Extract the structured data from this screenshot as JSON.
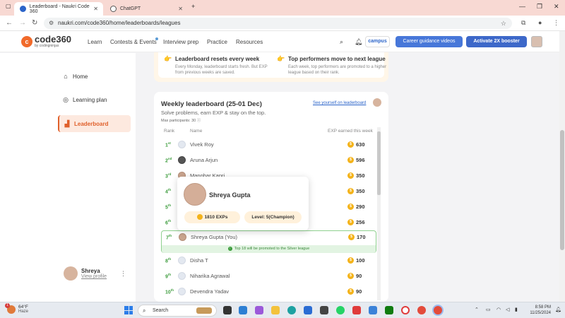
{
  "browser": {
    "tabs": [
      {
        "title": "Leaderboard - Naukri Code 360",
        "active": true,
        "favicon_color": "#2b64c9"
      },
      {
        "title": "ChatGPT",
        "active": false,
        "favicon_color": "#555555"
      }
    ],
    "url": "naukri.com/code360/home/leaderboards/leagues"
  },
  "header": {
    "logo_text": "code360",
    "logo_sub": "by codingninjas",
    "nav": [
      "Learn",
      "Contests & Events",
      "Interview prep",
      "Practice",
      "Resources"
    ],
    "campus_label": "campus",
    "career_btn": "Career guidance videos",
    "booster_btn": "Activate 2X booster"
  },
  "sidebar": {
    "items": [
      {
        "label": "Home",
        "icon": "home-icon",
        "active": false
      },
      {
        "label": "Learning plan",
        "icon": "compass-icon",
        "active": false
      },
      {
        "label": "Leaderboard",
        "icon": "leaderboard-icon",
        "active": true
      }
    ],
    "profile": {
      "name": "Shreya",
      "link": "View profile"
    }
  },
  "info": {
    "left": {
      "title": "Leaderboard resets every week",
      "desc": "Every Monday, leaderboard starts fresh. But EXP from previous weeks are saved."
    },
    "right": {
      "title": "Top performers move to next league",
      "desc": "Each week, top performers are promoted to a higher league based on their rank."
    }
  },
  "leaderboard": {
    "title": "Weekly leaderboard (25-01 Dec)",
    "subtitle": "Solve problems, earn EXP & stay on the top.",
    "max_participants": "Max participants: 30",
    "see_yourself": "See yourself on leaderboard",
    "col_rank": "Rank",
    "col_name": "Name",
    "col_exp": "EXP earned this week",
    "rows": [
      {
        "rank": "1",
        "suffix": "st",
        "name": "Vivek Roy",
        "exp": "630",
        "avatar": "default"
      },
      {
        "rank": "2",
        "suffix": "nd",
        "name": "Aruna Arjun",
        "exp": "596",
        "avatar": "dark"
      },
      {
        "rank": "3",
        "suffix": "rd",
        "name": "Manohar Kapri",
        "exp": "350",
        "avatar": "photo"
      },
      {
        "rank": "4",
        "suffix": "th",
        "name": "",
        "exp": "350",
        "avatar": "default"
      },
      {
        "rank": "5",
        "suffix": "th",
        "name": "",
        "exp": "290",
        "avatar": "default"
      },
      {
        "rank": "6",
        "suffix": "th",
        "name": "",
        "exp": "256",
        "avatar": "default"
      },
      {
        "rank": "7",
        "suffix": "th",
        "name": "Shreya Gupta (You)",
        "exp": "170",
        "avatar": "photo"
      },
      {
        "rank": "8",
        "suffix": "th",
        "name": "Disha T",
        "exp": "100",
        "avatar": "default"
      },
      {
        "rank": "9",
        "suffix": "th",
        "name": "Niharika Agrawal",
        "exp": "90",
        "avatar": "default"
      },
      {
        "rank": "10",
        "suffix": "th",
        "name": "Devendra Yadav",
        "exp": "90",
        "avatar": "default"
      }
    ],
    "promo_text": "Top 18 will be promoted to the Silver league"
  },
  "popup": {
    "name": "Shreya Gupta",
    "exps": "1810 EXPs",
    "level": "Level: 5(Champion)"
  },
  "taskbar": {
    "temp": "64°F",
    "condition": "Haze",
    "badge": "1",
    "search_label": "Search",
    "time": "8:58 PM",
    "date": "11/25/2024"
  }
}
